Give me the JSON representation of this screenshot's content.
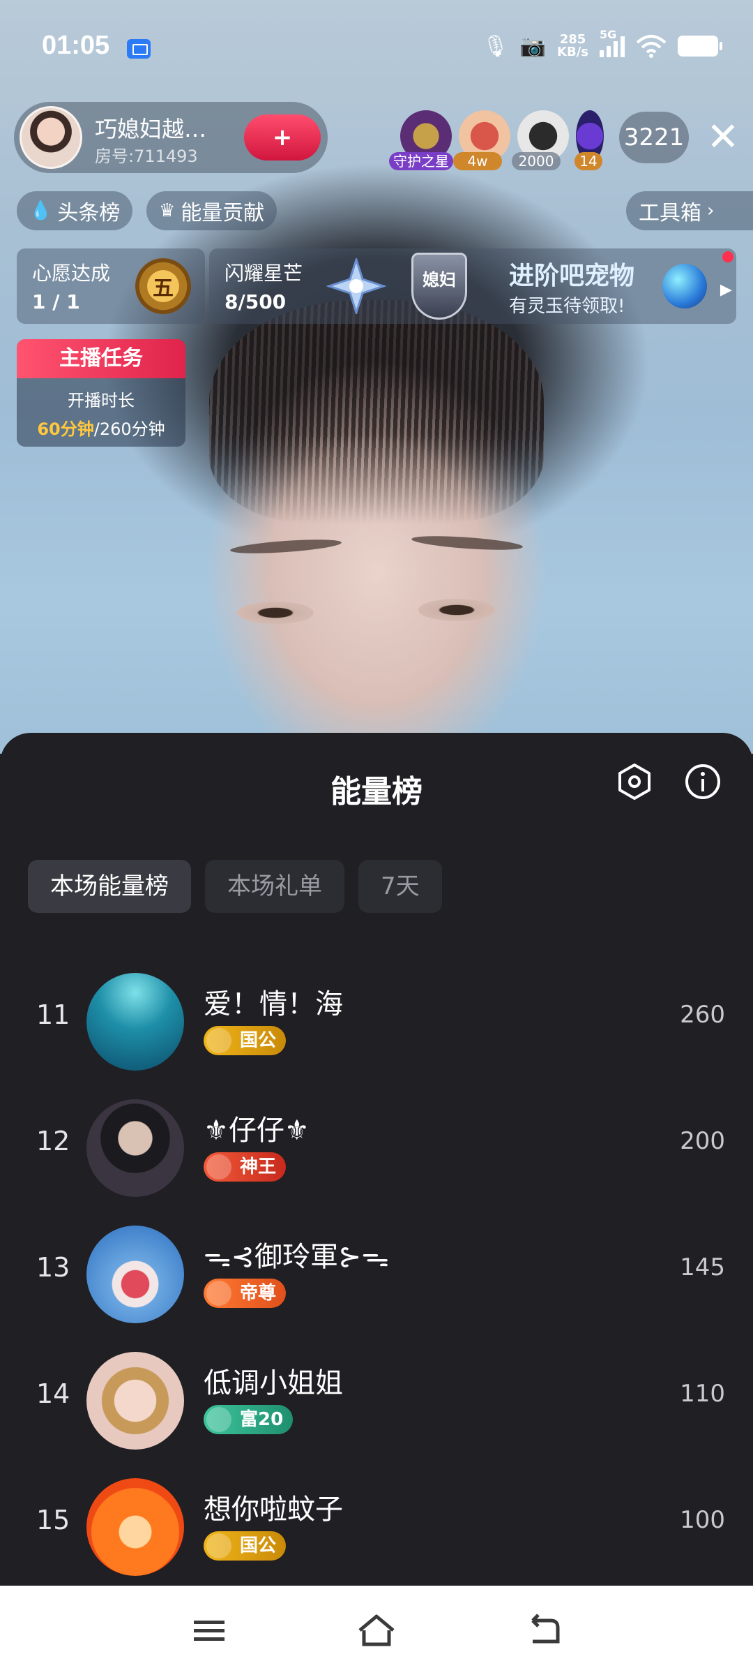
{
  "status_bar": {
    "time": "01:05",
    "net_speed_value": "285",
    "net_speed_unit": "KB/s",
    "network": "5G"
  },
  "host": {
    "name": "巧媳妇越…",
    "room": "房号:711493",
    "follow_label": "+"
  },
  "viewers": {
    "badges": [
      "守护之星",
      "4w",
      "2000",
      "14"
    ],
    "count": "3221"
  },
  "chips": {
    "headline_rank": "头条榜",
    "energy_contrib": "能量贡献",
    "toolbox": "工具箱"
  },
  "panels": {
    "wish_title": "心愿达成",
    "wish_value": "1 / 1",
    "wish_medal": "五",
    "star_title": "闪耀星芒",
    "star_value": "8/500",
    "shield_text": "媳妇",
    "pet_title": "进阶吧宠物",
    "pet_subtitle": "有灵玉待领取!"
  },
  "task": {
    "title": "主播任务",
    "line1": "开播时长",
    "done": "60分钟",
    "total": "/260分钟"
  },
  "sheet": {
    "title": "能量榜",
    "tabs": [
      "本场能量榜",
      "本场礼单",
      "7天"
    ],
    "rows": [
      {
        "rank": "11",
        "name": "爱！情！海",
        "badge": "国公",
        "score": "260"
      },
      {
        "rank": "12",
        "name": "⚜仔仔⚜",
        "badge": "神王",
        "score": "200"
      },
      {
        "rank": "13",
        "name": "ᯓ⊰御玲軍⊱ᯓ",
        "badge": "帝尊",
        "score": "145"
      },
      {
        "rank": "14",
        "name": "低调小姐姐",
        "badge": "富20",
        "score": "110"
      },
      {
        "rank": "15",
        "name": "想你啦蚊子",
        "badge": "国公",
        "score": "100"
      }
    ]
  },
  "colors": {
    "badge_guogong": "#e0a312",
    "badge_shenwang": "#e2452b",
    "badge_dizun": "#f0642a",
    "badge_fu": "#2fa88a",
    "sheet_bg": "#1f1f24",
    "accent_red": "#e0234b"
  }
}
